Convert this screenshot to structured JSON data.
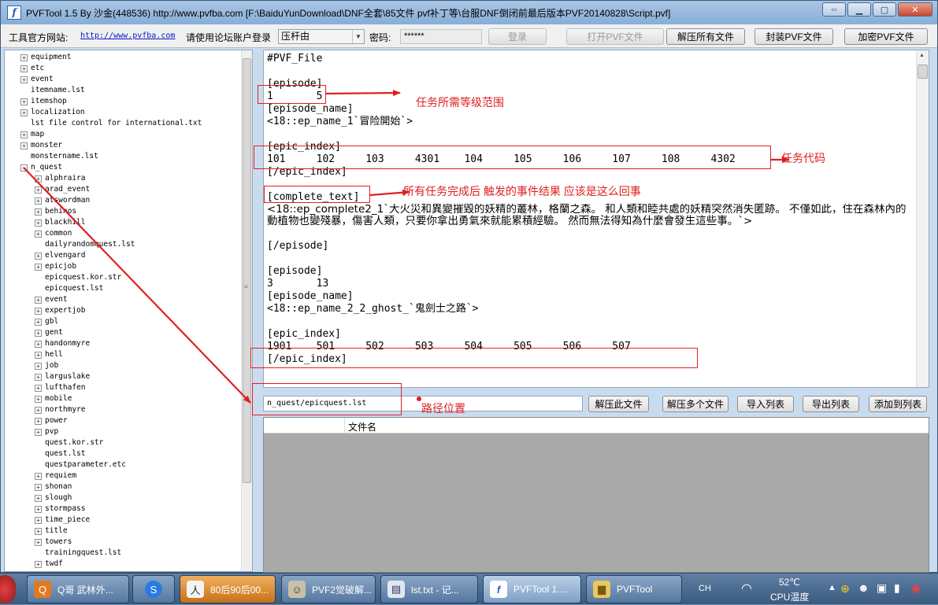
{
  "window": {
    "title": "PVFTool 1.5 By 沙金(448536) http://www.pvfba.com [F:\\BaiduYunDownload\\DNF全套\\85文件 pvf补丁等\\台服DNF倒闭前最后版本PVF20140828\\Script.pvf]"
  },
  "toolbar": {
    "site_label": "工具官方网站:",
    "site_link": "http://www.pvfba.com",
    "login_prompt": "请使用论坛账户登录",
    "account_value": "压杆由",
    "password_label": "密码:",
    "password_value": "******",
    "login_button": "登录",
    "open_button": "打开PVF文件",
    "extract_all_button": "解压所有文件",
    "pack_button": "封装PVF文件",
    "encrypt_button": "加密PVF文件"
  },
  "tree": {
    "items": [
      {
        "label": "equipment",
        "level": 0,
        "expandable": true
      },
      {
        "label": "etc",
        "level": 0,
        "expandable": true
      },
      {
        "label": "event",
        "level": 0,
        "expandable": true
      },
      {
        "label": "itemname.lst",
        "level": 0,
        "expandable": false
      },
      {
        "label": "itemshop",
        "level": 0,
        "expandable": true
      },
      {
        "label": "localization",
        "level": 0,
        "expandable": true
      },
      {
        "label": "lst file control for international.txt",
        "level": 0,
        "expandable": false
      },
      {
        "label": "map",
        "level": 0,
        "expandable": true
      },
      {
        "label": "monster",
        "level": 0,
        "expandable": true
      },
      {
        "label": "monstername.lst",
        "level": 0,
        "expandable": false
      },
      {
        "label": "n_quest",
        "level": 0,
        "expandable": true,
        "expanded": true
      },
      {
        "label": "alphraira",
        "level": 1,
        "expandable": true
      },
      {
        "label": "arad_event",
        "level": 1,
        "expandable": true
      },
      {
        "label": "atswordman",
        "level": 1,
        "expandable": true
      },
      {
        "label": "behinos",
        "level": 1,
        "expandable": true
      },
      {
        "label": "blackhill",
        "level": 1,
        "expandable": true
      },
      {
        "label": "common",
        "level": 1,
        "expandable": true
      },
      {
        "label": "dailyrandomquest.lst",
        "level": 1,
        "expandable": false
      },
      {
        "label": "elvengard",
        "level": 1,
        "expandable": true
      },
      {
        "label": "epicjob",
        "level": 1,
        "expandable": true
      },
      {
        "label": "epicquest.kor.str",
        "level": 1,
        "expandable": false
      },
      {
        "label": "epicquest.lst",
        "level": 1,
        "expandable": false
      },
      {
        "label": "event",
        "level": 1,
        "expandable": true
      },
      {
        "label": "expertjob",
        "level": 1,
        "expandable": true
      },
      {
        "label": "gbl",
        "level": 1,
        "expandable": true
      },
      {
        "label": "gent",
        "level": 1,
        "expandable": true
      },
      {
        "label": "handonmyre",
        "level": 1,
        "expandable": true
      },
      {
        "label": "hell",
        "level": 1,
        "expandable": true
      },
      {
        "label": "job",
        "level": 1,
        "expandable": true
      },
      {
        "label": "larguslake",
        "level": 1,
        "expandable": true
      },
      {
        "label": "lufthafen",
        "level": 1,
        "expandable": true
      },
      {
        "label": "mobile",
        "level": 1,
        "expandable": true
      },
      {
        "label": "northmyre",
        "level": 1,
        "expandable": true
      },
      {
        "label": "power",
        "level": 1,
        "expandable": true
      },
      {
        "label": "pvp",
        "level": 1,
        "expandable": true
      },
      {
        "label": "quest.kor.str",
        "level": 1,
        "expandable": false
      },
      {
        "label": "quest.lst",
        "level": 1,
        "expandable": false
      },
      {
        "label": "questparameter.etc",
        "level": 1,
        "expandable": false
      },
      {
        "label": "requiem",
        "level": 1,
        "expandable": true
      },
      {
        "label": "shonan",
        "level": 1,
        "expandable": true
      },
      {
        "label": "slough",
        "level": 1,
        "expandable": true
      },
      {
        "label": "stormpass",
        "level": 1,
        "expandable": true
      },
      {
        "label": "time_piece",
        "level": 1,
        "expandable": true
      },
      {
        "label": "title",
        "level": 1,
        "expandable": true
      },
      {
        "label": "towers",
        "level": 1,
        "expandable": true
      },
      {
        "label": "trainingquest.lst",
        "level": 1,
        "expandable": false
      },
      {
        "label": "twdf",
        "level": 1,
        "expandable": true
      }
    ]
  },
  "editor": {
    "lines": [
      "#PVF_File",
      "",
      "[episode]",
      "1       5",
      "[episode_name]",
      "<18::ep_name_1`冒险開始`>",
      "",
      "[epic_index]",
      "101     102     103     4301    104     105     106     107     108     4302",
      "[/epic_index]",
      "",
      "[complete_text]",
      "<18::ep_complete2_1`大火災和異變摧毀的妖精的叢林，格蘭之森。 和人類和睦共處的妖精突然消失匿跡。 不僅如此，住在森林內的動植物也變殘暴，傷害人類，只要你拿出勇氣來就能累積經驗。 然而無法得知為什麼會發生這些事。`>",
      "",
      "[/episode]",
      "",
      "[episode]",
      "3       13",
      "[episode_name]",
      "<18::ep_name_2_2_ghost_`鬼劍士之路`>",
      "",
      "[epic_index]",
      "1901    501     502     503     504     505     506     507",
      "[/epic_index]"
    ]
  },
  "path": {
    "value": "n_quest/epicquest.lst"
  },
  "actions": {
    "extract_this": "解压此文件",
    "extract_many": "解压多个文件",
    "import_list": "导入列表",
    "export_list": "导出列表",
    "add_to_list": "添加到列表"
  },
  "file_list": {
    "columns": [
      "",
      "文件名"
    ]
  },
  "annotations": {
    "level_range": "任务所需等级范围",
    "task_code": "任务代码",
    "complete_event": "所有任务完成后  触发的事件结果 应该是这么回事",
    "path_location": "路径位置",
    "color": "#e02020"
  },
  "taskbar": {
    "tasks": [
      {
        "label": "Q哥 武林外...",
        "icon": "qq-game-icon"
      },
      {
        "label": "",
        "icon": "sogou-browser-icon"
      },
      {
        "label": "80后90后00...",
        "icon": "photo-icon"
      },
      {
        "label": "PVF2觉破解...",
        "icon": "character-icon"
      },
      {
        "label": "lst.txt - 记...",
        "icon": "notepad-icon"
      },
      {
        "label": "PVFTool 1....",
        "icon": "pvftool-icon"
      },
      {
        "label": "PVFTool",
        "icon": "folder-icon"
      }
    ],
    "ime": "CH",
    "temp": "52℃",
    "temp_label": "CPU温度"
  }
}
